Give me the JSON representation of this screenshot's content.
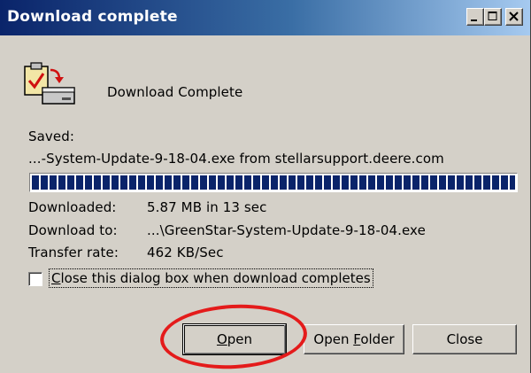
{
  "window": {
    "title": "Download complete",
    "controls": [
      "minimize",
      "maximize",
      "close"
    ]
  },
  "header": {
    "icon": "download-complete-icon",
    "status": "Download Complete"
  },
  "saved": {
    "label": "Saved:",
    "file_line": "...-System-Update-9-18-04.exe from stellarsupport.deere.com"
  },
  "progress": {
    "fraction": 1.0
  },
  "details": {
    "downloaded_label": "Downloaded:",
    "downloaded_value": "5.87 MB in 13 sec",
    "download_to_label": "Download to:",
    "download_to_value": "...\\GreenStar-System-Update-9-18-04.exe",
    "rate_label": "Transfer rate:",
    "rate_value": "462 KB/Sec"
  },
  "checkbox": {
    "label": "Close this dialog box when download completes",
    "checked": false
  },
  "buttons": {
    "open": "Open",
    "open_folder": "Open Folder",
    "close": "Close"
  },
  "annotation": {
    "color": "#e41b1b",
    "target": "open-button"
  },
  "colors": {
    "title_start": "#0a246a",
    "title_end": "#a6caf0",
    "dialog_bg": "#d4d0c8",
    "progress_block": "#0a246a"
  }
}
